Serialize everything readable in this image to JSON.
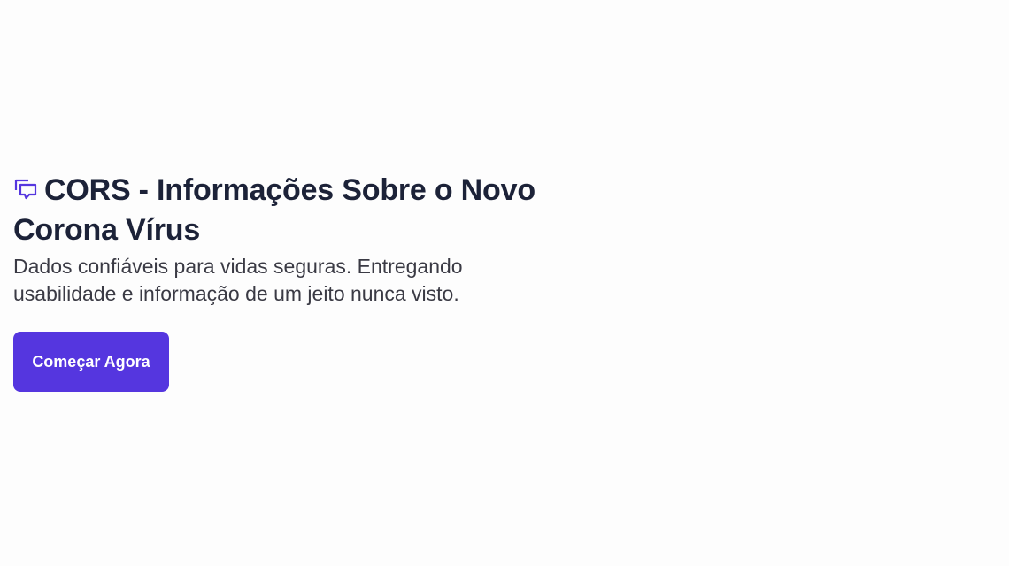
{
  "hero": {
    "title": "CORS - Informações Sobre o Novo Corona Vírus",
    "subtitle": "Dados confiáveis para vidas seguras. Entregando usabilidade e informação de um jeito nunca visto.",
    "icon": "chat-bubbles-icon"
  },
  "cta": {
    "label": "Começar Agora"
  },
  "colors": {
    "accent": "#5536df",
    "heading": "#1c2238",
    "body_text": "#3a3a44",
    "background": "#fdfdfd"
  }
}
